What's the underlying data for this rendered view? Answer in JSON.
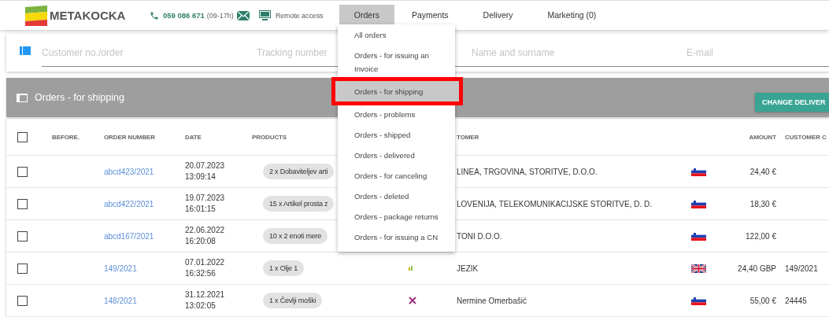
{
  "header": {
    "logo": "METAKOCKA",
    "phone": "059 086 671",
    "hours": "(09-17h)",
    "remote_access": "Remote access",
    "nav": [
      {
        "label": "Orders",
        "selected": true
      },
      {
        "label": "Payments",
        "selected": false
      },
      {
        "label": "Delivery",
        "selected": false
      },
      {
        "label": "Marketing (0)",
        "selected": false
      }
    ]
  },
  "dropdown": [
    {
      "label": "All orders",
      "selected": false
    },
    {
      "label": "Orders - for issuing an Invoice",
      "selected": false
    },
    {
      "label": "Orders - for shipping",
      "selected": true
    },
    {
      "label": "Orders - problems",
      "selected": false
    },
    {
      "label": "Orders - shipped",
      "selected": false
    },
    {
      "label": "Orders - delivered",
      "selected": false
    },
    {
      "label": "Orders - for canceling",
      "selected": false
    },
    {
      "label": "Orders - deleted",
      "selected": false
    },
    {
      "label": "Orders - package returns",
      "selected": false
    },
    {
      "label": "Orders - for issuing a CN",
      "selected": false
    }
  ],
  "search": [
    {
      "placeholder": "Customer no./order"
    },
    {
      "placeholder": "Tracking number"
    },
    {
      "placeholder": "Name and surname"
    },
    {
      "placeholder": "E-mail"
    }
  ],
  "panel": {
    "title": "Orders - for shipping",
    "button": "CHANGE DELIVER"
  },
  "table": {
    "select_all": {
      "checked": false
    },
    "columns": [
      "BEFORE.",
      "ORDER NUMBER",
      "DATE",
      "PRODUCTS",
      "TOMER",
      "AMOUNT",
      "CUSTOMER C"
    ],
    "rows": [
      {
        "checked": false,
        "order": "abcd423/2021",
        "date": "20.07.2023",
        "time": "13:09:14",
        "product": "2 x Dobaviteljev arti",
        "customer": "LINEA, TRGOVINA, STORITVE, D.O.O.",
        "flag": {
          "kind": "si"
        },
        "amount": "24,40 €"
      },
      {
        "checked": false,
        "order": "abcd422/2021",
        "date": "19.07.2023",
        "time": "16:01:15",
        "product": "15 x Artikel prosta z",
        "customer": "LOVENIJA, TELEKOMUNIKACIJSKE STORITVE, D. D.",
        "flag": {
          "kind": "si"
        },
        "amount": "18,30 €"
      },
      {
        "checked": false,
        "order": "abcd167/2021",
        "date": "22.06.2022",
        "time": "16:20:08",
        "product": "10 x 2 enoti mere",
        "customer": "TONI D.O.O.",
        "flag": {
          "kind": "si"
        },
        "amount": "122,00 €"
      },
      {
        "checked": false,
        "order": "149/2021",
        "date": "07.01.2022",
        "time": "16:32:56",
        "product": "1 x Olje 1",
        "status": {
          "kind": "bars"
        },
        "customer": "JEZIK",
        "flag": {
          "kind": "gb"
        },
        "amount": "24,40 GBP",
        "code": "149/2021"
      },
      {
        "checked": false,
        "order": "148/2021",
        "date": "31.12.2021",
        "time": "13:02:05",
        "product": "1 x Čevlji moški",
        "status": {
          "kind": "cancelled"
        },
        "customer": "Nermine Omerbašić",
        "flag": {
          "kind": "si"
        },
        "amount": "55,00 €",
        "code": "24445"
      }
    ]
  }
}
